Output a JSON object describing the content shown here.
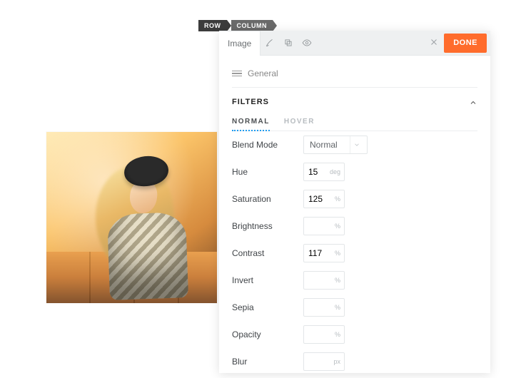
{
  "crumbs": {
    "row": "ROW",
    "column": "COLUMN"
  },
  "panel": {
    "tab_label": "Image",
    "done_label": "DONE",
    "general_label": "General",
    "section_title": "FILTERS",
    "subtabs": {
      "normal": "NORMAL",
      "hover": "HOVER"
    },
    "blend_mode": {
      "label": "Blend Mode",
      "value": "Normal"
    },
    "rows": {
      "hue": {
        "label": "Hue",
        "value": "15",
        "unit": "deg"
      },
      "saturation": {
        "label": "Saturation",
        "value": "125",
        "unit": "%"
      },
      "brightness": {
        "label": "Brightness",
        "value": "",
        "unit": "%"
      },
      "contrast": {
        "label": "Contrast",
        "value": "117",
        "unit": "%"
      },
      "invert": {
        "label": "Invert",
        "value": "",
        "unit": "%"
      },
      "sepia": {
        "label": "Sepia",
        "value": "",
        "unit": "%"
      },
      "opacity": {
        "label": "Opacity",
        "value": "",
        "unit": "%"
      },
      "blur": {
        "label": "Blur",
        "value": "",
        "unit": "px"
      }
    }
  }
}
